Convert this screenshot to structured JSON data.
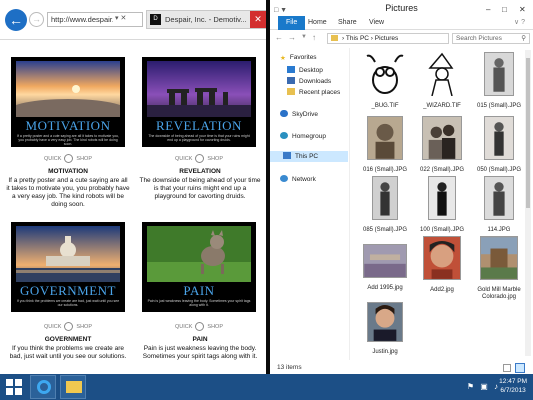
{
  "ie": {
    "address": "http://www.despair.co",
    "address_icons": "▾ ✕",
    "tab_title": "Despair, Inc. - Demotiv...",
    "tab_favicon": "D",
    "close_glyph": "✕"
  },
  "posters": [
    {
      "poster_word": "MOTIVATION",
      "poster_sub": "If a pretty poster and a cute saying are all it takes to motivate you, you probably have a very easy job. The kind robots will be doing soon.",
      "quick": "QUICK",
      "shop": "SHOP",
      "title": "MOTIVATION",
      "desc": "If a pretty poster and a cute saying are all it takes to motivate you, you probably have a very easy job. The kind robots will be doing soon."
    },
    {
      "poster_word": "REVELATION",
      "poster_sub": "The downside of being ahead of your time is that your ruins might end up a playground for cavorting druids.",
      "quick": "QUICK",
      "shop": "SHOP",
      "title": "REVELATION",
      "desc": "The downside of being ahead of your time is that your ruins might end up a playground for cavorting druids."
    },
    {
      "poster_word": "GOVERNMENT",
      "poster_sub": "If you think the problems we create are bad, just wait until you see our solutions.",
      "quick": "QUICK",
      "shop": "SHOP",
      "title": "GOVERNMENT",
      "desc": "If you think the problems we create are bad, just wait until you see our solutions."
    },
    {
      "poster_word": "PAIN",
      "poster_sub": "Pain is just weakness leaving the body. Sometimes your spirit tags along with it.",
      "quick": "QUICK",
      "shop": "SHOP",
      "title": "PAIN",
      "desc": "Pain is just weakness leaving the body. Sometimes your spirit tags along with it."
    }
  ],
  "explorer": {
    "title": "Pictures",
    "ribbon_tabs": [
      "File",
      "Home",
      "Share",
      "View"
    ],
    "path": "› This PC › Pictures",
    "search_placeholder": "Search Pictures",
    "nav": {
      "favorites": "Favorites",
      "desktop": "Desktop",
      "downloads": "Downloads",
      "recent": "Recent places",
      "skydrive": "SkyDrive",
      "homegroup": "Homegroup",
      "thispc": "This PC",
      "network": "Network"
    },
    "files": [
      "_BUG.TIF",
      "_WIZARD.TIF",
      "015 (Small).JPG",
      "016 (Small).JPG",
      "022 (Small).JPG",
      "050 (Small).JPG",
      "085 (Small).JPG",
      "100 (Small).JPG",
      "114.JPG",
      "Add 1995.jpg",
      "Add2.jpg",
      "Gold Mill Marble Colorado.jpg",
      "Justin.jpg"
    ],
    "status": "13 items"
  },
  "taskbar": {
    "time": "12:47 PM",
    "date": "6/7/2013",
    "tray_icons": "⚑ ▣ ♪"
  }
}
